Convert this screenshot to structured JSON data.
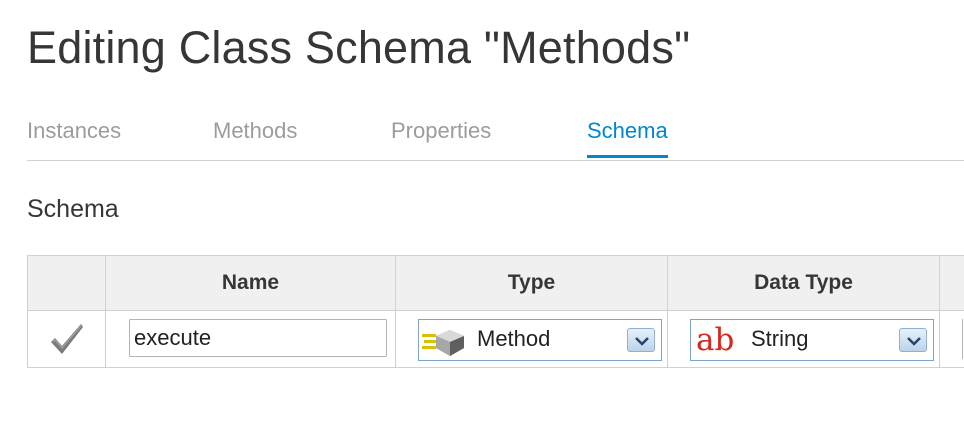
{
  "header": {
    "title": "Editing Class Schema \"Methods\""
  },
  "tabs": [
    {
      "label": "Instances"
    },
    {
      "label": "Methods"
    },
    {
      "label": "Properties"
    },
    {
      "label": "Schema"
    }
  ],
  "active_tab": "Schema",
  "section": {
    "title": "Schema"
  },
  "grid": {
    "columns": [
      "",
      "Name",
      "Type",
      "Data Type",
      ""
    ],
    "rows": [
      {
        "checked": true,
        "name": "execute",
        "type": "Method",
        "data_type": "String",
        "data_type_icon_text": "ab"
      }
    ]
  },
  "colors": {
    "accent": "#0088ce",
    "inactive_tab": "#9c9c9c",
    "header_bg": "#f0f0f0",
    "string_icon": "#d12a1f"
  }
}
